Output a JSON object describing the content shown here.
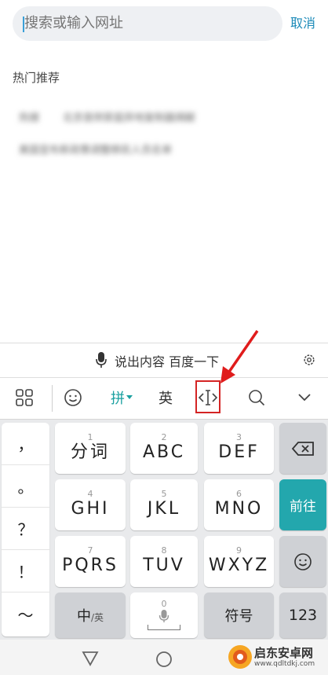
{
  "search": {
    "placeholder": "搜索或输入网址",
    "cancel_label": "取消"
  },
  "hot": {
    "title": "热门推荐",
    "items": [
      "热搜",
      "北京首例家庭异地复制器捐献",
      "美国宣布新政策调整移民人员名单"
    ]
  },
  "keyboard": {
    "voice_prompt": "说出内容 百度一下",
    "toolbar": {
      "pinyin_label": "拼",
      "english_label": "英"
    },
    "punctuation": [
      "，",
      "。",
      "？",
      "！",
      "～"
    ],
    "rows": [
      [
        {
          "num": "1",
          "label": "分词"
        },
        {
          "num": "2",
          "label": "ABC"
        },
        {
          "num": "3",
          "label": "DEF"
        }
      ],
      [
        {
          "num": "4",
          "label": "GHI"
        },
        {
          "num": "5",
          "label": "JKL"
        },
        {
          "num": "6",
          "label": "MNO"
        }
      ],
      [
        {
          "num": "7",
          "label": "PQRS"
        },
        {
          "num": "8",
          "label": "TUV"
        },
        {
          "num": "9",
          "label": "WXYZ"
        }
      ]
    ],
    "go_label": "前往",
    "zhong_label": "中",
    "ying_small": "/英",
    "space_num": "0",
    "symbol_label": "符号",
    "num_label": "123",
    "accent_color": "#23a7ad"
  },
  "watermark": {
    "text": "启东安卓网",
    "url": "www.qdltdkj.com"
  }
}
